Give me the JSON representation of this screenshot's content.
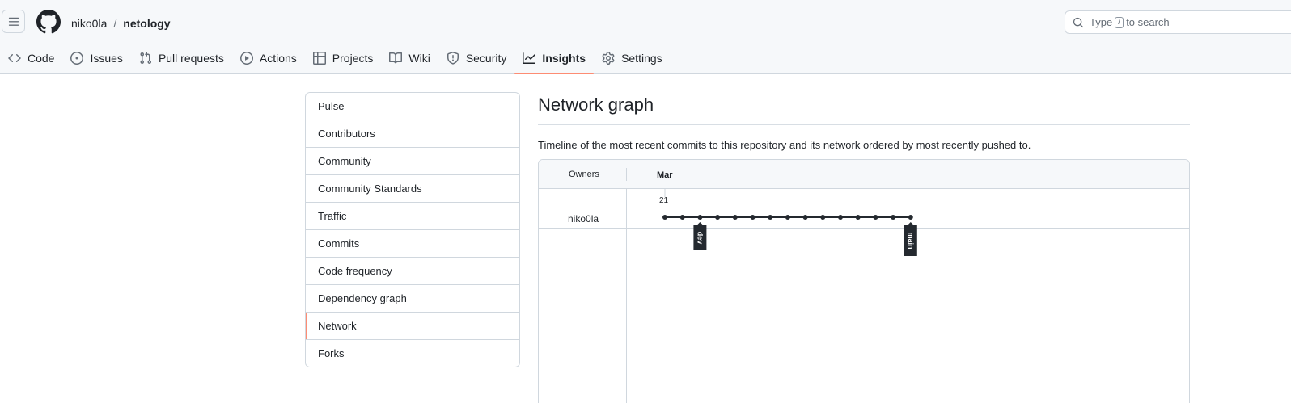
{
  "header": {
    "owner": "niko0la",
    "separator": "/",
    "repo": "netology",
    "search": {
      "prefix": "Type",
      "key": "/",
      "suffix": "to search"
    }
  },
  "tabs": [
    {
      "label": "Code",
      "icon": "code-icon",
      "selected": false
    },
    {
      "label": "Issues",
      "icon": "issue-opened-icon",
      "selected": false
    },
    {
      "label": "Pull requests",
      "icon": "git-pull-request-icon",
      "selected": false
    },
    {
      "label": "Actions",
      "icon": "play-icon",
      "selected": false
    },
    {
      "label": "Projects",
      "icon": "table-icon",
      "selected": false
    },
    {
      "label": "Wiki",
      "icon": "book-icon",
      "selected": false
    },
    {
      "label": "Security",
      "icon": "shield-icon",
      "selected": false
    },
    {
      "label": "Insights",
      "icon": "graph-icon",
      "selected": true
    },
    {
      "label": "Settings",
      "icon": "gear-icon",
      "selected": false
    }
  ],
  "sidebar": {
    "items": [
      {
        "label": "Pulse",
        "selected": false
      },
      {
        "label": "Contributors",
        "selected": false
      },
      {
        "label": "Community",
        "selected": false
      },
      {
        "label": "Community Standards",
        "selected": false
      },
      {
        "label": "Traffic",
        "selected": false
      },
      {
        "label": "Commits",
        "selected": false
      },
      {
        "label": "Code frequency",
        "selected": false
      },
      {
        "label": "Dependency graph",
        "selected": false
      },
      {
        "label": "Network",
        "selected": true
      },
      {
        "label": "Forks",
        "selected": false
      }
    ]
  },
  "main": {
    "title": "Network graph",
    "description": "Timeline of the most recent commits to this repository and its network ordered by most recently pushed to."
  },
  "network": {
    "owners_header": "Owners",
    "month": "Mar",
    "day": "21",
    "owner": "niko0la",
    "commit_count": 15,
    "branches": [
      {
        "name": "dev",
        "commit_index": 2
      },
      {
        "name": "main",
        "commit_index": 14
      }
    ]
  },
  "colors": {
    "accent": "#fd8c73",
    "border": "#d0d7de",
    "header_bg": "#f6f8fa",
    "label_bg": "#24292f"
  }
}
